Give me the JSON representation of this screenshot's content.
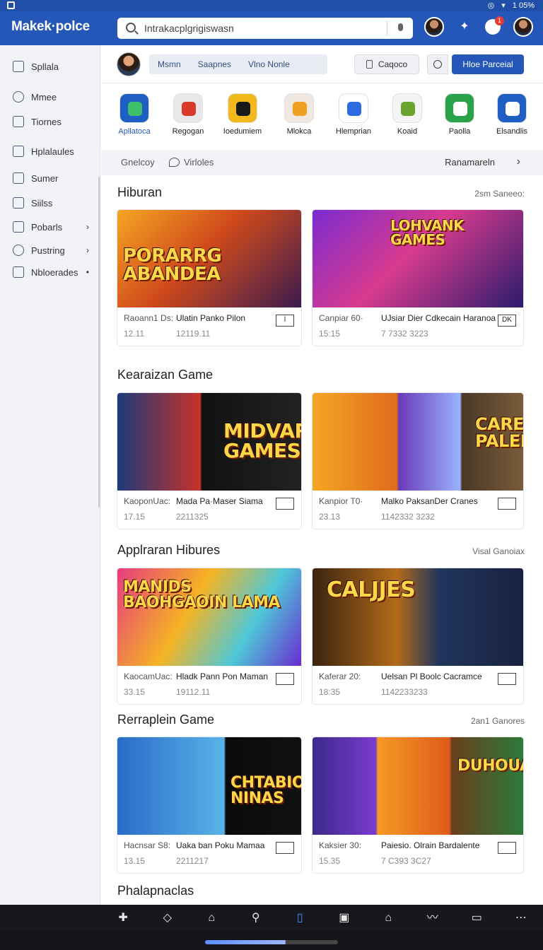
{
  "status": {
    "battery": "1 05%"
  },
  "app": {
    "brand": "Makek·polce"
  },
  "search": {
    "value": "Intrakacplgrigiswasn"
  },
  "sidebar": {
    "items": [
      {
        "label": "Spllala",
        "icon": "home-icon"
      },
      {
        "label": "Mmee",
        "icon": "circle-icon"
      },
      {
        "label": "Tiornes",
        "icon": "box-icon"
      },
      {
        "label": "Hplalaules",
        "icon": "bag-icon"
      },
      {
        "label": "Sumer",
        "icon": "users-icon"
      },
      {
        "label": "Siilss",
        "icon": "edit-icon"
      },
      {
        "label": "Pobarls",
        "icon": "list-icon",
        "chevron": "›"
      },
      {
        "label": "Pustring",
        "icon": "gear-icon",
        "chevron": "›"
      },
      {
        "label": "Nbloerades",
        "icon": "grid-icon",
        "chevron": "•"
      }
    ]
  },
  "toprow": {
    "tabs": [
      "Msmn",
      "Saapnes",
      "Vlno  Nonle"
    ],
    "catalog_label": "Caqoco",
    "primary_label": "Hloe Parceial"
  },
  "apps": [
    {
      "label": "Apllatoca",
      "color": "#1f5fc4",
      "accent": "#3ec06a"
    },
    {
      "label": "Regogan",
      "color": "#e8e8e8",
      "accent": "#d93a2b"
    },
    {
      "label": "Ioedumiem",
      "color": "#f2b81c",
      "accent": "#1a1a1a"
    },
    {
      "label": "Mlokca",
      "color": "#efe7e0",
      "accent": "#f0a020"
    },
    {
      "label": "Hlemprian",
      "color": "#ffffff",
      "accent": "#2f6be0"
    },
    {
      "label": "Koaid",
      "color": "#f4f4f4",
      "accent": "#6aa42f"
    },
    {
      "label": "Paolla",
      "color": "#2aa24a",
      "accent": "#ffffff"
    },
    {
      "label": "Elsandlis",
      "color": "#1f5fc4",
      "accent": "#ffffff"
    }
  ],
  "filters": {
    "left": "Gnelcoy",
    "chat": "Virloles",
    "right": "Ranamareln",
    "arrow": "›"
  },
  "sections": [
    {
      "title": "Hiburan",
      "right": "2sm Saneeo:",
      "cards": [
        {
          "thumb_title": "PORARRG ABANDEA",
          "line1a": "Raoann1 Ds:",
          "line1b": "Ulatin Panko Pilon",
          "line2a": "12.11",
          "line2b": "12119.11",
          "box": "l"
        },
        {
          "thumb_title": "LOHVANK GAMES",
          "line1a": "Canpiar 60·",
          "line1b": "UJsiar Dier Cdkecain Haranoa",
          "line2a": "15:15",
          "line2b": "7 7332 3223",
          "box": "DK"
        }
      ]
    },
    {
      "title": "Kearaizan Game",
      "right": "",
      "cards": [
        {
          "thumb_title": "MIDVAR GAMES",
          "line1a": "KaoponUac:",
          "line1b": "Mada Pa·Maser Siama",
          "line2a": "17.15",
          "line2b": "2211325",
          "box": ""
        },
        {
          "thumb_title": "CARERS PALENDR",
          "line1a": "Kanpior T0·",
          "line1b": "Malko PaksanDer Cranes",
          "line2a": "23.13",
          "line2b": "1142332 3232",
          "box": ""
        }
      ]
    },
    {
      "title": "Applraran Hibures",
      "right": "Visal Ganoiax",
      "cards": [
        {
          "thumb_title": "MANIDS BAOHGAOIN LAMA",
          "line1a": "KaocamUac:",
          "line1b": "Hladk Pann Pon Maman",
          "line2a": "33.15",
          "line2b": "19112.11",
          "box": ""
        },
        {
          "thumb_title": "CALJJES",
          "line1a": "Kaferar 20:",
          "line1b": "Uelsan Pl Boolc Cacramce",
          "line2a": "18:35",
          "line2b": "1142233233",
          "box": ""
        }
      ]
    },
    {
      "title": "Rerraplein Game",
      "right": "2an1 Ganores",
      "cards": [
        {
          "thumb_title": "CHTABIO NINAS",
          "line1a": "Hacnsar S8:",
          "line1b": "Uaka ban Poku Mamaa",
          "line2a": "13.15",
          "line2b": "2211217",
          "box": ""
        },
        {
          "thumb_title": "DUHOUAS",
          "line1a": "Kaksier 30:",
          "line1b": "Paiesio. Olrain Bardalente",
          "line2a": "15.35",
          "line2b": "7 C393 3C27",
          "box": ""
        }
      ]
    }
  ],
  "last_section_title": "Phalapnaclas",
  "bottomnav": [
    "plus-icon",
    "tag-icon",
    "bookmark-icon",
    "people-icon",
    "book-icon",
    "doc-icon",
    "home-icon",
    "wave-icon",
    "chat-icon",
    "more-icon"
  ],
  "bottomnav_glyphs": [
    "✚",
    "◇",
    "⌂",
    "⚲",
    "▯",
    "▣",
    "⌂",
    "〰",
    "▭",
    "⋯"
  ]
}
